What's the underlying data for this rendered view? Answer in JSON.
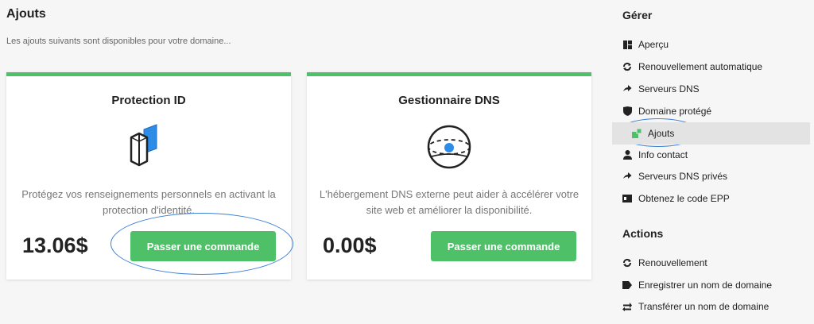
{
  "main": {
    "title": "Ajouts",
    "subtitle": "Les ajouts suivants sont disponibles pour votre domaine..."
  },
  "cards": [
    {
      "title": "Protection ID",
      "icon": "id-protection-icon",
      "description": "Protégez vos renseignements personnels en activant la protection d'identité.",
      "price": "13.06$",
      "button": "Passer une commande"
    },
    {
      "title": "Gestionnaire DNS",
      "icon": "dns-globe-icon",
      "description": "L'hébergement DNS externe peut aider à accélérer votre site web et améliorer la disponibilité.",
      "price": "0.00$",
      "button": "Passer une commande"
    }
  ],
  "sidebar": {
    "manage_heading": "Gérer",
    "manage_items": [
      {
        "label": "Aperçu",
        "icon": "dashboard-icon"
      },
      {
        "label": "Renouvellement automatique",
        "icon": "sync-icon"
      },
      {
        "label": "Serveurs DNS",
        "icon": "arrow-right-icon"
      },
      {
        "label": "Domaine protégé",
        "icon": "shield-icon"
      },
      {
        "label": "Ajouts",
        "icon": "addons-icon",
        "active": true
      },
      {
        "label": "Info contact",
        "icon": "user-icon"
      },
      {
        "label": "Serveurs DNS privés",
        "icon": "arrow-right-icon"
      },
      {
        "label": "Obtenez le code EPP",
        "icon": "id-card-icon"
      }
    ],
    "actions_heading": "Actions",
    "action_items": [
      {
        "label": "Renouvellement",
        "icon": "sync-icon"
      },
      {
        "label": "Enregistrer un nom de domaine",
        "icon": "tag-icon"
      },
      {
        "label": "Transférer un nom de domaine",
        "icon": "exchange-icon"
      }
    ]
  },
  "colors": {
    "accent_green": "#4ec168",
    "highlight_blue": "#3b7fd6",
    "active_bg": "#e3e3e3"
  }
}
